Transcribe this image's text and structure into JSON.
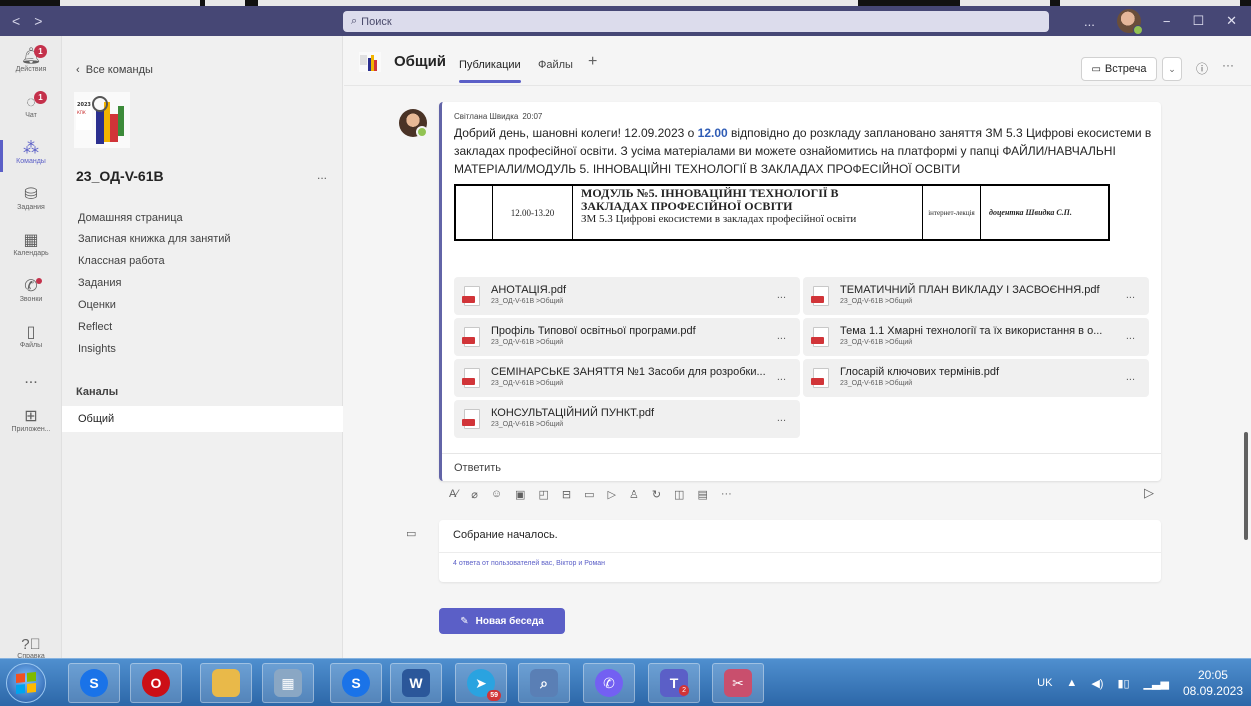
{
  "titlebar": {
    "search_placeholder": "Поиск",
    "nav_back": "<",
    "nav_forward": ">",
    "more": "...",
    "minimize": "−",
    "maximize": "☐",
    "close": "✕"
  },
  "rail": [
    {
      "label": "Действия",
      "icon": "bell-icon",
      "badge": "1"
    },
    {
      "label": "Чат",
      "icon": "chat-icon",
      "badge": "1"
    },
    {
      "label": "Команды",
      "icon": "teams-icon",
      "active": true
    },
    {
      "label": "Задания",
      "icon": "assignments-icon"
    },
    {
      "label": "Календарь",
      "icon": "calendar-icon"
    },
    {
      "label": "Звонки",
      "icon": "phone-icon"
    },
    {
      "label": "Файлы",
      "icon": "file-icon"
    },
    {
      "label": "...",
      "icon": "more-icon"
    },
    {
      "label": "Приложен...",
      "icon": "apps-icon"
    }
  ],
  "help_label": "Справка",
  "sidebar": {
    "back_label": "Все команды",
    "team_name": "23_ОД-V-61B",
    "team_more": "...",
    "nav": [
      "Домашняя страница",
      "Записная книжка для занятий",
      "Классная работа",
      "Задания",
      "Оценки",
      "Reflect",
      "Insights"
    ],
    "channels_header": "Каналы",
    "channel": "Общий"
  },
  "channel_header": {
    "title": "Общий",
    "tabs": [
      "Публикации",
      "Файлы"
    ],
    "active_tab": "Публикации",
    "add_tab": "+",
    "meet_label": "Встреча",
    "caret": "⌄",
    "info": "ⓘ",
    "more": "···"
  },
  "post": {
    "author": "Світлана Швидка",
    "time": "20:07",
    "text_before": "Добрий день, шановні колеги! 12.09.2023 о ",
    "text_time": "12.00",
    "text_after": " відповідно до розкладу заплановано заняття ЗМ 5.3 Цифрові екосистеми в закладах професійної освіти. З усіма матеріалами ви можете ознайомитись на платформі у папці ФАЙЛИ/НАВЧАЛЬНІ МАТЕРІАЛИ/МОДУЛЬ 5. ІННОВАЦІЙНІ ТЕХНОЛОГІЇ В ЗАКЛАДАХ ПРОФЕСІЙНОЇ ОСВІТИ",
    "schedule": {
      "time": "12.00-13.20",
      "module_line1": "МОДУЛЬ №5. ІННОВАЦІЙНІ ТЕХНОЛОГІЇ В",
      "module_line2": "ЗАКЛАДАХ ПРОФЕСІЙНОЇ ОСВІТИ",
      "subject": "ЗМ 5.3 Цифрові екосистеми в закладах професійної освіти",
      "type": "інтернет-лекція",
      "lecturer": "доцентка Швидка С.П."
    },
    "files": [
      {
        "name": "АНОТАЦІЯ.pdf",
        "path": "23_ОД-V-61В >Общий"
      },
      {
        "name": "ТЕМАТИЧНИЙ ПЛАН ВИКЛАДУ І ЗАСВОЄННЯ.pdf",
        "path": "23_ОД-V-61В >Общий"
      },
      {
        "name": "Профіль Типової освітньої програми.pdf",
        "path": "23_ОД-V-61В >Общий"
      },
      {
        "name": "Тема 1.1 Хмарні технології та їх використання в о...",
        "path": "23_ОД-V-61В >Общий"
      },
      {
        "name": "СЕМІНАРСЬКЕ ЗАНЯТТЯ №1 Засоби для розробки...",
        "path": "23_ОД-V-61В >Общий"
      },
      {
        "name": "Глосарій ключових термінів.pdf",
        "path": "23_ОД-V-61В >Общий"
      },
      {
        "name": "КОНСУЛЬТАЦІЙНИЙ ПУНКТ.pdf",
        "path": "23_ОД-V-61В >Общий"
      }
    ],
    "file_more": "...",
    "reply_label": "Ответить"
  },
  "compose_toolbar": [
    "format-icon",
    "attach-icon",
    "emoji-icon",
    "gif-icon",
    "sticker-icon",
    "schedule-meeting-icon",
    "video-icon",
    "stream-icon",
    "praise-icon",
    "loop-icon",
    "forms-icon",
    "onenote-icon",
    "more-icon"
  ],
  "meeting": {
    "title": "Собрание началось.",
    "replies": "4 ответа от пользователей вас, Віктор и Роман"
  },
  "new_conversation_label": "Новая беседа",
  "taskbar": {
    "apps": [
      {
        "name": "chrome-s",
        "color": "#1a73e8"
      },
      {
        "name": "opera",
        "color": "#cc0f16"
      },
      {
        "name": "explorer",
        "color": "#e9b949"
      },
      {
        "name": "calculator",
        "color": "#8aa7c4"
      },
      {
        "name": "chrome-s2",
        "color": "#1a73e8"
      },
      {
        "name": "word",
        "color": "#2b579a",
        "text": "W"
      },
      {
        "name": "telegram",
        "color": "#2aa3e0",
        "count": "59"
      },
      {
        "name": "magnifier",
        "color": "#5a7fb5"
      },
      {
        "name": "viber",
        "color": "#7360f2"
      },
      {
        "name": "teams",
        "color": "#5b5fc7",
        "text": "T",
        "count": "2"
      },
      {
        "name": "snipping-tool",
        "color": "#c94f6d"
      }
    ],
    "lang": "UK",
    "time": "20:05",
    "date": "08.09.2023"
  }
}
